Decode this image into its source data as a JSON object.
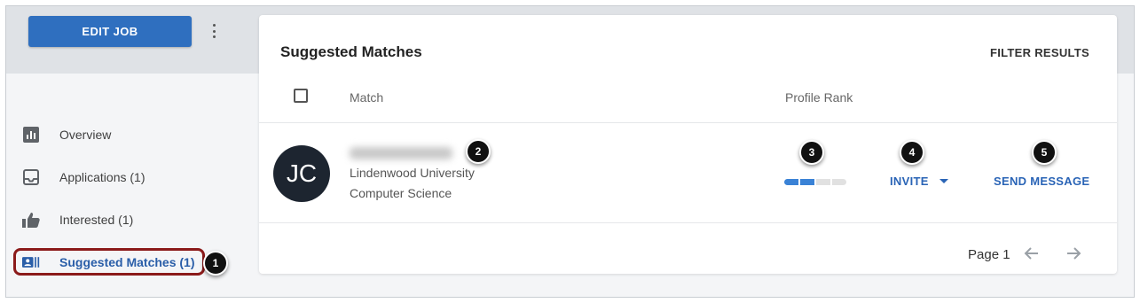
{
  "header": {
    "edit_job_label": "EDIT JOB",
    "more_icon": "kebab-vertical-icon"
  },
  "sidebar": {
    "items": [
      {
        "label": "Overview",
        "icon": "bar-chart-icon"
      },
      {
        "label": "Applications (1)",
        "icon": "inbox-icon"
      },
      {
        "label": "Interested (1)",
        "icon": "thumbs-up-icon"
      },
      {
        "label": "Suggested Matches (1)",
        "icon": "contact-card-icon",
        "active": true
      }
    ]
  },
  "main": {
    "title": "Suggested Matches",
    "filter_label": "FILTER RESULTS",
    "columns": {
      "match": "Match",
      "profile_rank": "Profile Rank"
    },
    "rows": [
      {
        "initials": "JC",
        "school": "Lindenwood University",
        "major": "Computer Science",
        "rank_filled_fraction": 0.4,
        "invite_label": "INVITE",
        "send_label": "SEND MESSAGE"
      }
    ],
    "pagination": {
      "label": "Page 1"
    }
  },
  "callouts": [
    "1",
    "2",
    "3",
    "4",
    "5"
  ],
  "colors": {
    "accent": "#2f6fbf",
    "link": "#2a64b6",
    "highlight": "#8b1a1a",
    "avatar": "#1d2530"
  }
}
